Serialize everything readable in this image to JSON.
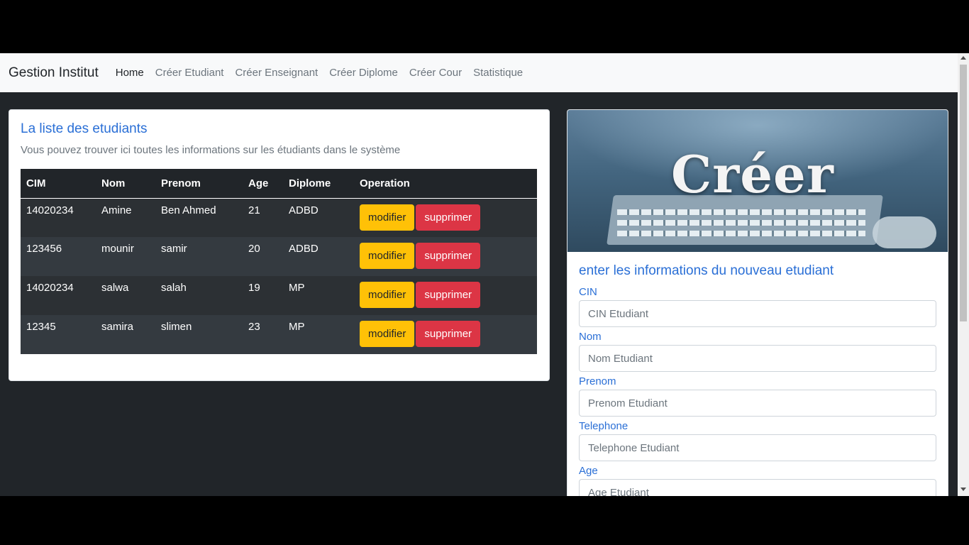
{
  "navbar": {
    "brand": "Gestion Institut",
    "links": [
      "Home",
      "Créer Etudiant",
      "Créer Enseignant",
      "Créer Diplome",
      "Créer Cour",
      "Statistique"
    ]
  },
  "list_card": {
    "title": "La liste des etudiants",
    "subtitle": "Vous pouvez trouver ici toutes les informations sur les étudiants dans le système",
    "columns": [
      "CIM",
      "Nom",
      "Prenom",
      "Age",
      "Diplome",
      "Operation"
    ],
    "rows": [
      [
        "14020234",
        "Amine",
        "Ben Ahmed",
        "21",
        "ADBD"
      ],
      [
        "123456",
        "mounir",
        "samir",
        "20",
        "ADBD"
      ],
      [
        "14020234",
        "salwa",
        "salah",
        "19",
        "MP"
      ],
      [
        "12345",
        "samira",
        "slimen",
        "23",
        "MP"
      ]
    ],
    "modify_label": "modifier",
    "delete_label": "supprimer"
  },
  "form_card": {
    "hero_text": "Créer",
    "title": "enter les informations du nouveau etudiant",
    "fields": [
      {
        "label": "CIN",
        "placeholder": "CIN Etudiant"
      },
      {
        "label": "Nom",
        "placeholder": "Nom Etudiant"
      },
      {
        "label": "Prenom",
        "placeholder": "Prenom Etudiant"
      },
      {
        "label": "Telephone",
        "placeholder": "Telephone Etudiant"
      },
      {
        "label": "Age",
        "placeholder": "Age Etudiant"
      }
    ]
  },
  "colors": {
    "accent": "#2a6fd6",
    "warning": "#ffc107",
    "danger": "#dc3545",
    "background": "#212529"
  }
}
